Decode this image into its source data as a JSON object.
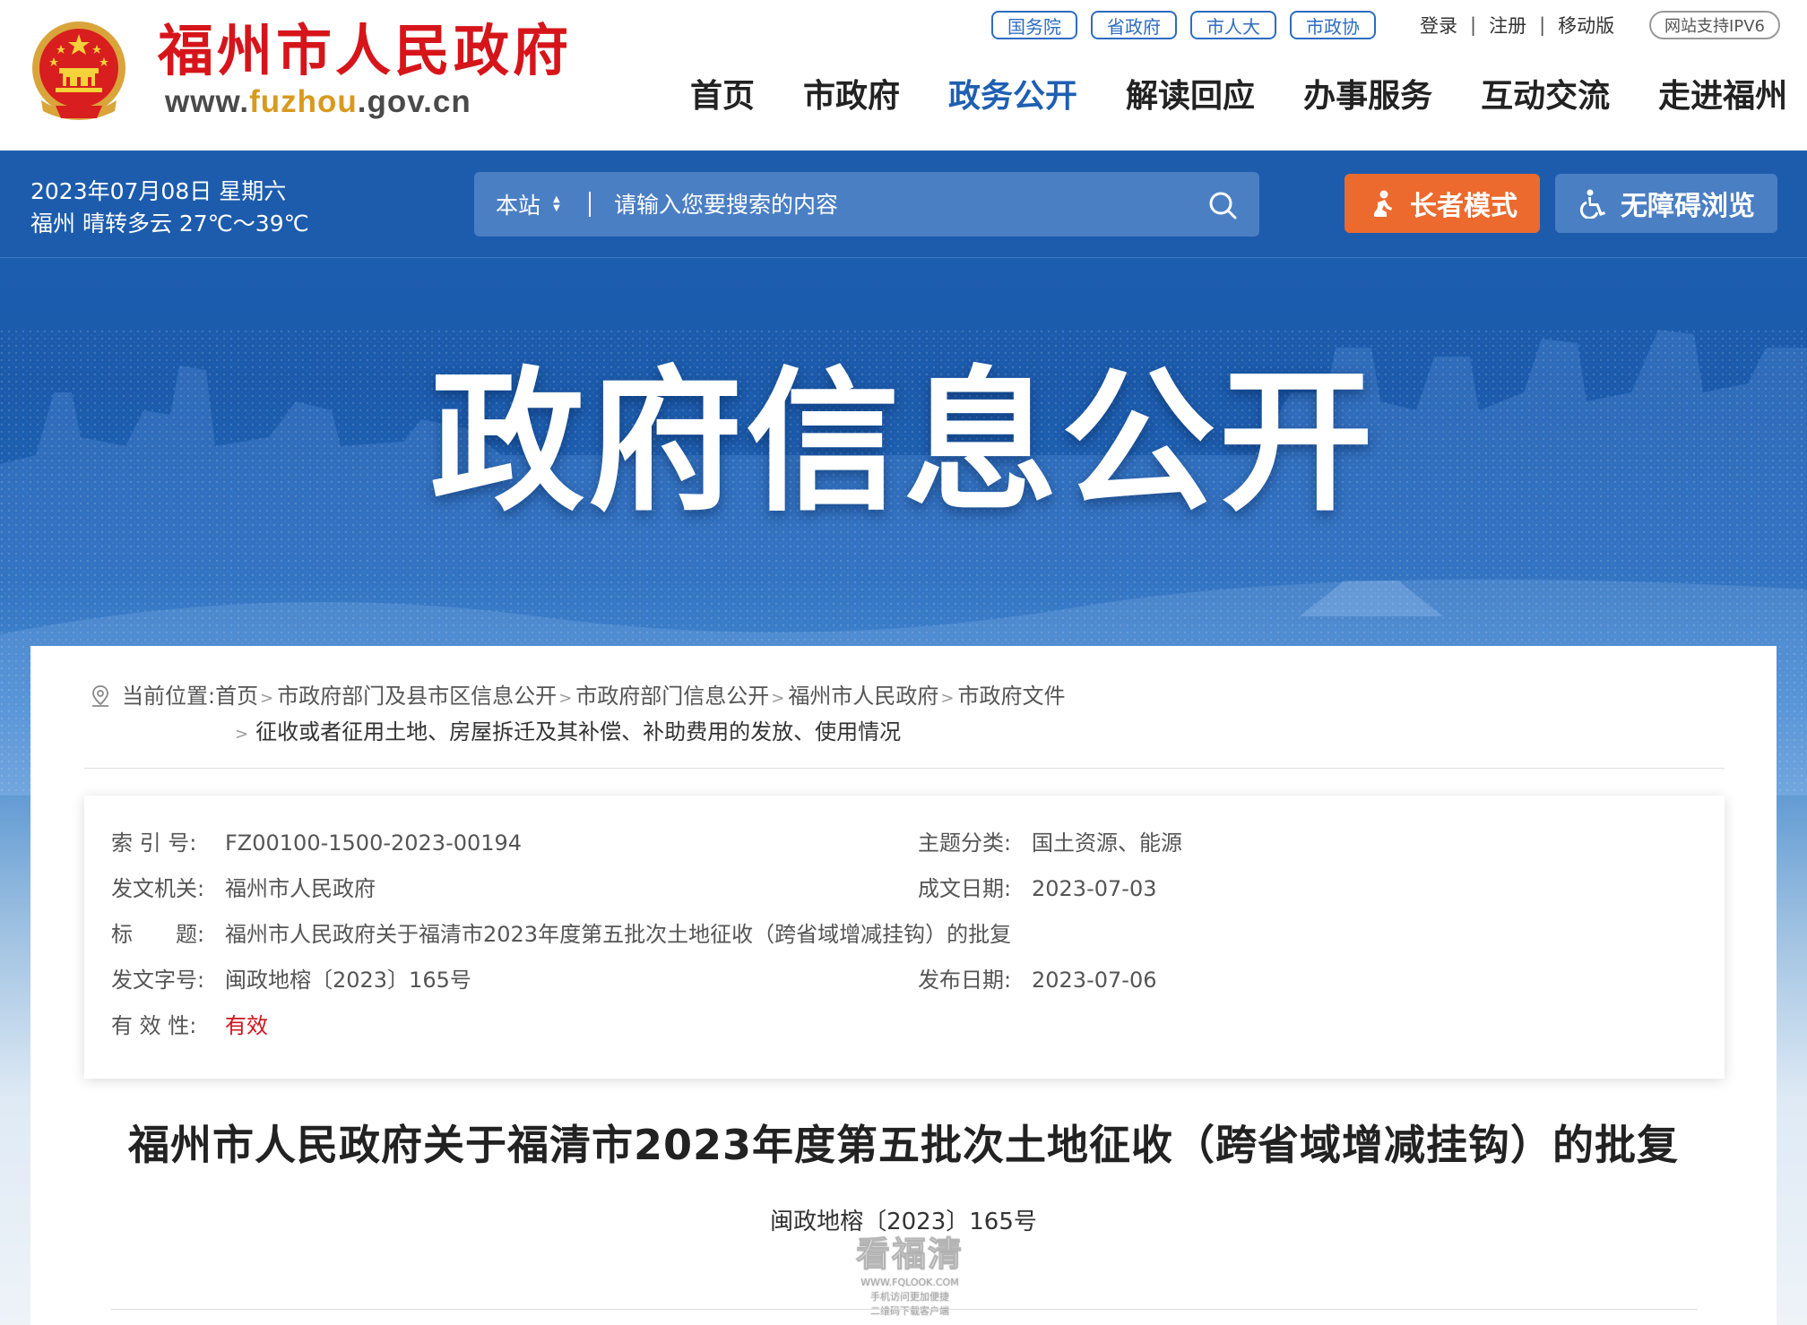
{
  "header": {
    "site_name": "福州市人民政府",
    "site_url_prefix": "www.",
    "site_url_highlight": "fuzhou",
    "site_url_suffix": ".gov.cn",
    "top_links": [
      "国务院",
      "省政府",
      "市人大",
      "市政协"
    ],
    "account": {
      "login": "登录",
      "separator": "|",
      "register": "注册",
      "mobile": "移动版"
    },
    "ipv6_badge": "网站支持IPV6",
    "nav": [
      "首页",
      "市政府",
      "政务公开",
      "解读回应",
      "办事服务",
      "互动交流",
      "走进福州"
    ],
    "active_nav": "政务公开"
  },
  "info_bar": {
    "date": "2023年07月08日 星期六",
    "weather": "福州 晴转多云 27℃～39℃",
    "search": {
      "scope": "本站",
      "placeholder": "请输入您要搜索的内容"
    },
    "elder_mode": "长者模式",
    "accessible": "无障碍浏览"
  },
  "banner": {
    "title": "政府信息公开"
  },
  "breadcrumb": {
    "prefix": "当前位置:",
    "items": [
      "首页",
      "市政府部门及县市区信息公开",
      "市政府部门信息公开",
      "福州市人民政府",
      "市政府文件"
    ],
    "current": "征收或者征用土地、房屋拆迁及其补偿、补助费用的发放、使用情况"
  },
  "meta": {
    "index_no": {
      "label": "索 引 号:",
      "value": "FZ00100-1500-2023-00194"
    },
    "topic": {
      "label": "主题分类:",
      "value": "国土资源、能源"
    },
    "issuer": {
      "label": "发文机关:",
      "value": "福州市人民政府"
    },
    "created": {
      "label": "成文日期:",
      "value": "2023-07-03"
    },
    "title": {
      "label": "标　　题:",
      "value": "福州市人民政府关于福清市2023年度第五批次土地征收（跨省域增减挂钩）的批复"
    },
    "doc_no": {
      "label": "发文字号:",
      "value": "闽政地榕〔2023〕165号"
    },
    "published": {
      "label": "发布日期:",
      "value": "2023-07-06"
    },
    "validity": {
      "label": "有 效 性:",
      "value": "有效"
    }
  },
  "document": {
    "title": "福州市人民政府关于福清市2023年度第五批次土地征收（跨省域增减挂钩）的批复",
    "number": "闽政地榕〔2023〕165号"
  },
  "watermark": {
    "brand": "看福清",
    "url": "WWW.FQLOOK.COM",
    "tagline1": "手机访问更加便捷",
    "tagline2": "二维码下载客户端"
  },
  "colors": {
    "brand_red": "#d6151b",
    "nav_blue": "#1e5fb3",
    "banner_blue": "#1d5cad",
    "elder_orange": "#ec6a2d",
    "validity_red": "#d0121b"
  }
}
